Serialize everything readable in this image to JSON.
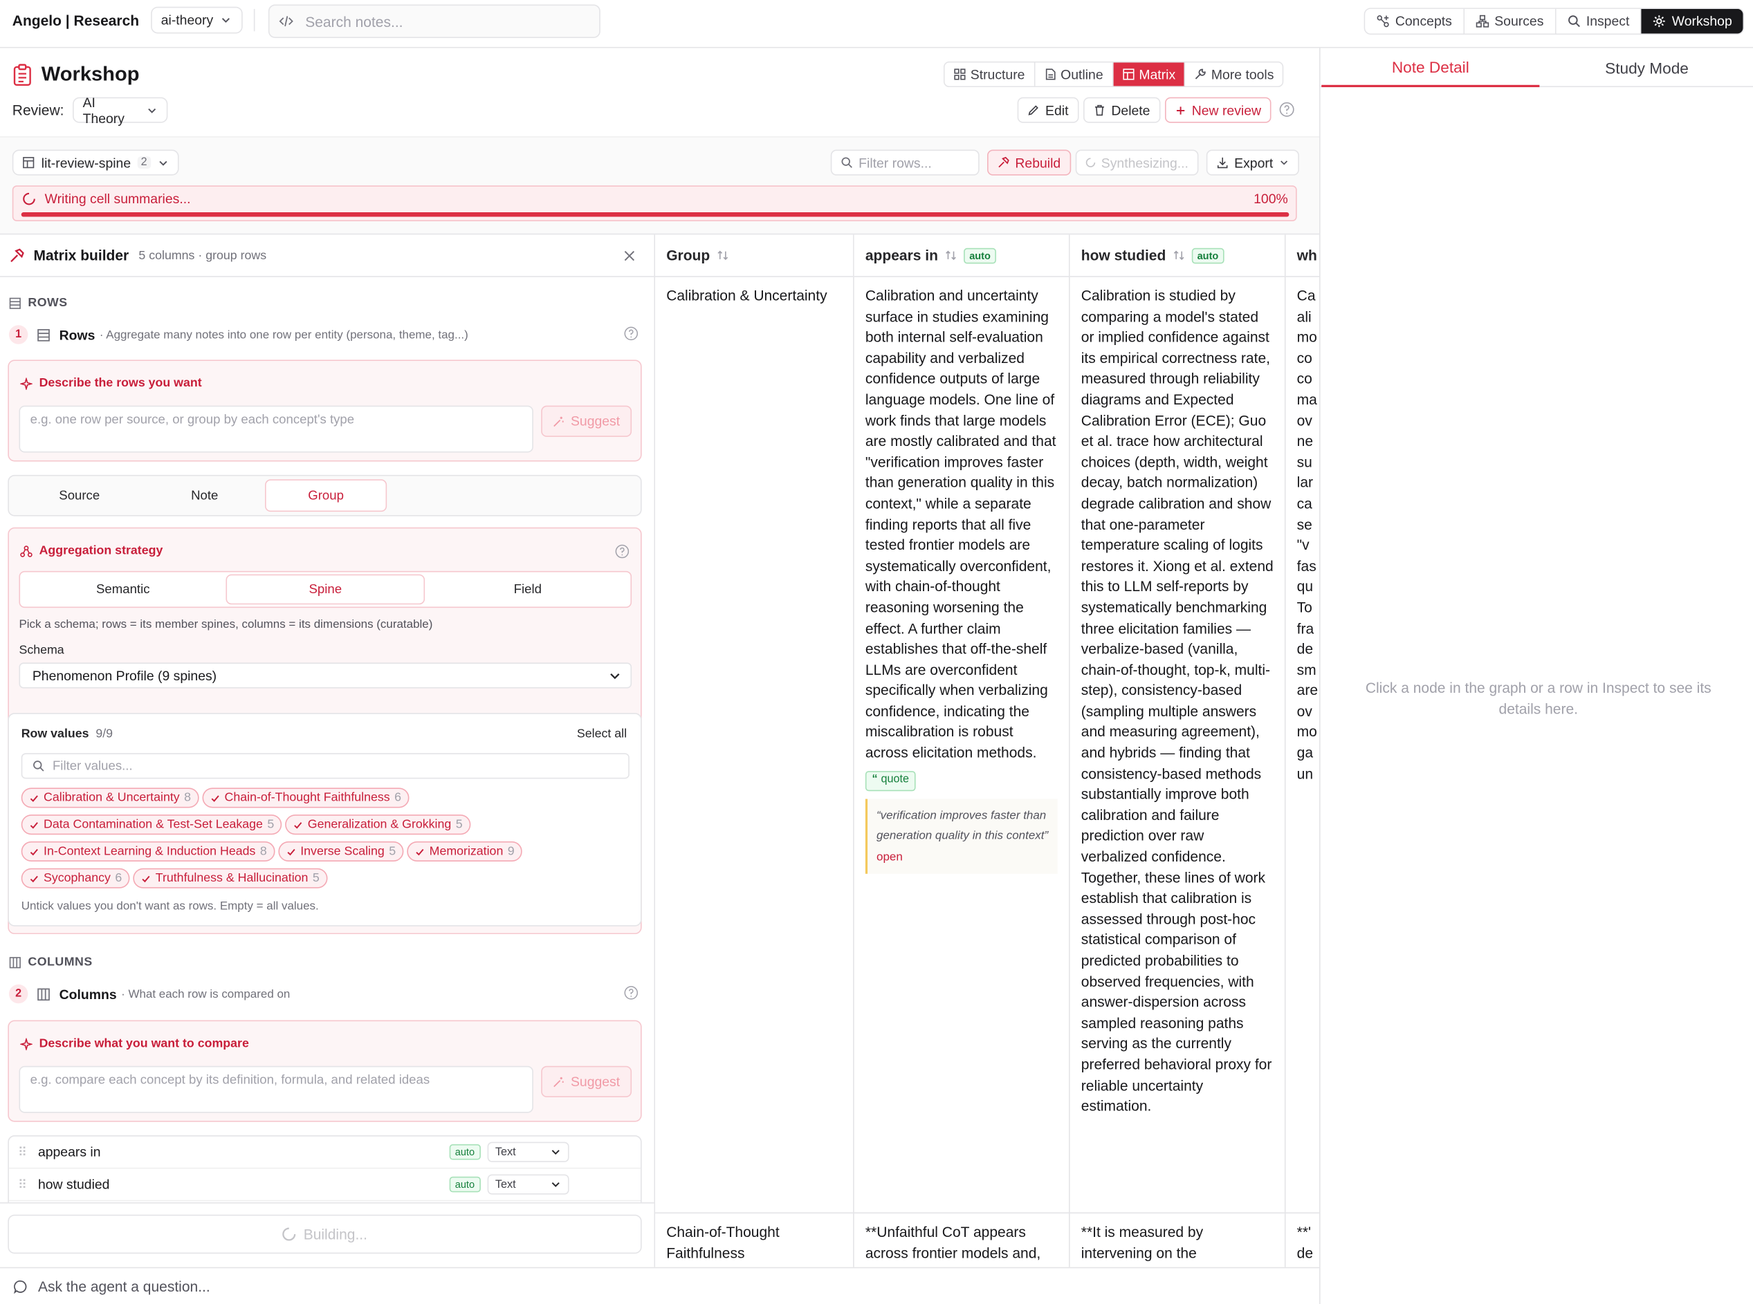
{
  "app": {
    "brand": "Angelo | Research",
    "project": "ai-theory",
    "search_placeholder": "Search notes..."
  },
  "nav": [
    {
      "label": "Concepts",
      "icon": "concepts-icon"
    },
    {
      "label": "Sources",
      "icon": "sources-icon"
    },
    {
      "label": "Inspect",
      "icon": "search-icon"
    },
    {
      "label": "Workshop",
      "icon": "gear-icon",
      "active": true
    }
  ],
  "workshop": {
    "title": "Workshop",
    "review_label": "Review:",
    "review_value": "AI Theory",
    "views": [
      "Structure",
      "Outline",
      "Matrix",
      "More tools"
    ],
    "active_view": "Matrix",
    "actions": {
      "edit": "Edit",
      "delete": "Delete",
      "new_review": "New review"
    }
  },
  "matrix_bar": {
    "name": "lit-review-spine",
    "count": "2",
    "filter_placeholder": "Filter rows...",
    "rebuild": "Rebuild",
    "synthesizing": "Synthesizing...",
    "export": "Export"
  },
  "progress": {
    "text": "Writing cell summaries...",
    "percent_label": "100%",
    "value": 1.0
  },
  "right_panel": {
    "tabs": [
      "Note Detail",
      "Study Mode"
    ],
    "active_tab": "Note Detail",
    "empty_text": "Click a node in the graph or a row in Inspect to see its details here."
  },
  "builder": {
    "title": "Matrix builder",
    "subtitle": "5 columns · group rows",
    "rows_section": "ROWS",
    "rows_step": {
      "num": "1",
      "label": "Rows",
      "hint": "· Aggregate many notes into one row per entity (persona, theme, tag...)"
    },
    "rows_prompt": {
      "title": "Describe the rows you want",
      "placeholder": "e.g. one row per source, or group by each concept's type",
      "suggest": "Suggest"
    },
    "row_modes": [
      "Source",
      "Note",
      "Group"
    ],
    "active_row_mode": "Group",
    "aggregation": {
      "title": "Aggregation strategy",
      "options": [
        "Semantic",
        "Spine",
        "Field"
      ],
      "active": "Spine",
      "hint": "Pick a schema; rows = its member spines, columns = its dimensions (curatable)",
      "schema_label": "Schema",
      "schema_value": "Phenomenon Profile (9 spines)"
    },
    "row_values": {
      "title": "Row values",
      "count": "9/9",
      "select_all": "Select all",
      "filter_placeholder": "Filter values...",
      "chips": [
        {
          "label": "Calibration & Uncertainty",
          "count": "8"
        },
        {
          "label": "Chain-of-Thought Faithfulness",
          "count": "6"
        },
        {
          "label": "Data Contamination & Test-Set Leakage",
          "count": "5"
        },
        {
          "label": "Generalization & Grokking",
          "count": "5"
        },
        {
          "label": "In-Context Learning & Induction Heads",
          "count": "8"
        },
        {
          "label": "Inverse Scaling",
          "count": "5"
        },
        {
          "label": "Memorization",
          "count": "9"
        },
        {
          "label": "Sycophancy",
          "count": "6"
        },
        {
          "label": "Truthfulness & Hallucination",
          "count": "5"
        }
      ],
      "footer": "Untick values you don't want as rows. Empty = all values."
    },
    "columns_section": "COLUMNS",
    "columns_step": {
      "num": "2",
      "label": "Columns",
      "hint": "· What each row is compared on"
    },
    "columns_prompt": {
      "title": "Describe what you want to compare",
      "placeholder": "e.g. compare each concept by its definition, formula, and related ideas",
      "suggest": "Suggest"
    },
    "columns": [
      {
        "name": "appears in",
        "badge": "auto",
        "type": "Text"
      },
      {
        "name": "how studied",
        "badge": "auto",
        "type": "Text"
      }
    ],
    "building": "Building..."
  },
  "matrix": {
    "headers": [
      {
        "label": "Group"
      },
      {
        "label": "appears in",
        "badge": "auto"
      },
      {
        "label": "how studied",
        "badge": "auto"
      },
      {
        "label": "wh"
      }
    ],
    "rows": [
      {
        "group": "Calibration & Uncertainty",
        "appears_in": "Calibration and uncertainty surface in studies examining both internal self-evaluation capability and verbalized confidence outputs of large language models. One line of work finds that large models are mostly calibrated and that \"verification improves faster than generation quality in this context,\" while a separate finding reports that all five tested frontier models are systematically overconfident, with chain-of-thought reasoning worsening the effect. A further claim establishes that off-the-shelf LLMs are overconfident specifically when verbalizing confidence, indicating the miscalibration is robust across elicitation methods.",
        "quote_badge": "quote",
        "quote_text": "“verification improves faster than generation quality in this context”",
        "quote_link": "open",
        "how_studied": "Calibration is studied by comparing a model's stated or implied confidence against its empirical correctness rate, measured through reliability diagrams and Expected Calibration Error (ECE); Guo et al. trace how architectural choices (depth, width, weight decay, batch normalization) degrade calibration and show that one-parameter temperature scaling of logits restores it. Xiong et al. extend this to LLM self-reports by systematically benchmarking three elicitation families — verbalize-based (vanilla, chain-of-thought, top-k, multi-step), consistency-based (sampling multiple answers and measuring agreement), and hybrids — finding that consistency-based methods substantially improve both calibration and failure prediction over raw verbalized confidence. Together, these lines of work establish that calibration is assessed through post-hoc statistical comparison of predicted probabilities to observed frequencies, with answer-dispersion across sampled reasoning paths serving as the currently preferred behavioral proxy for reliable uncertainty estimation.",
        "col4": "Ca ali mo co co ma ov ne su lar ca se \"v fas qu To fra de sm are ov mo ga un"
      },
      {
        "group": "Chain-of-Thought Faithfulness",
        "appears_in": "**Unfaithful CoT appears across frontier models and,",
        "how_studied": "**It is measured by intervening on the",
        "col4": "**' de"
      }
    ]
  },
  "ask": {
    "placeholder": "Ask the agent a question..."
  },
  "colors": {
    "accent": "#dc2f44",
    "accent_light": "#fdeef0",
    "green": "#16803c",
    "dark": "#18181b"
  }
}
